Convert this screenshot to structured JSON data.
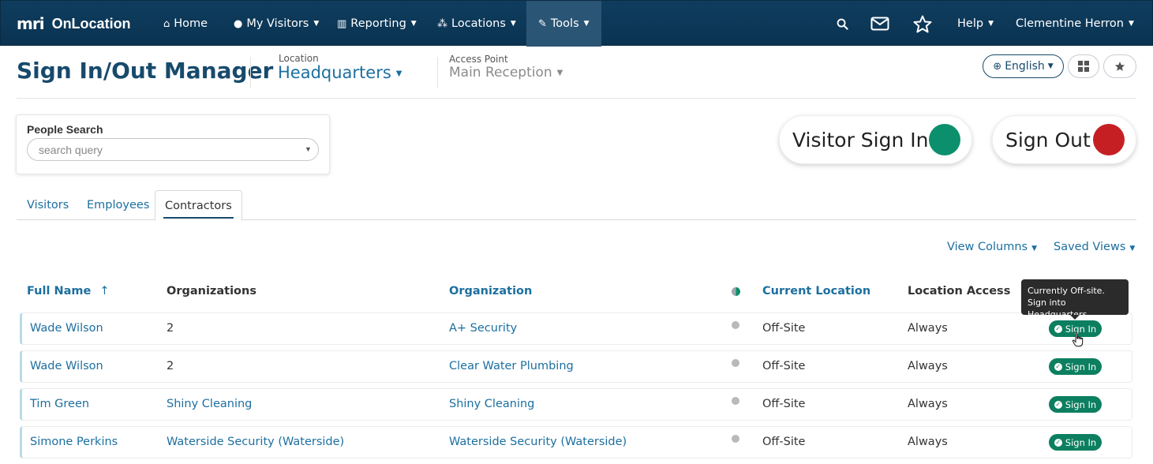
{
  "nav": {
    "brand_mark": "mri",
    "brand_name": "OnLocation",
    "home": "Home",
    "my_visitors": "My Visitors",
    "reporting": "Reporting",
    "locations": "Locations",
    "tools": "Tools",
    "help": "Help",
    "user": "Clementine Herron"
  },
  "header": {
    "title": "Sign In/Out Manager",
    "location_label": "Location",
    "location_value": "Headquarters",
    "access_point_label": "Access Point",
    "access_point_value": "Main Reception",
    "language": "English"
  },
  "search": {
    "label": "People Search",
    "placeholder": "search query"
  },
  "actions": {
    "visitor_sign_in": "Visitor Sign In",
    "sign_out": "Sign Out"
  },
  "tabs": [
    {
      "label": "Visitors"
    },
    {
      "label": "Employees"
    },
    {
      "label": "Contractors"
    }
  ],
  "view_tools": {
    "view_columns": "View Columns",
    "saved_views": "Saved Views"
  },
  "table": {
    "headers": {
      "full_name": "Full Name",
      "sort_indicator": "↑",
      "organizations": "Organizations",
      "organization": "Organization",
      "current_location": "Current Location",
      "location_access": "Location Access"
    },
    "rows": [
      {
        "name": "Wade Wilson",
        "organizations": "2",
        "organization": "A+ Security",
        "current_location": "Off-Site",
        "access": "Always",
        "action": "Sign In"
      },
      {
        "name": "Wade Wilson",
        "organizations": "2",
        "organization": "Clear Water Plumbing",
        "current_location": "Off-Site",
        "access": "Always",
        "action": "Sign In"
      },
      {
        "name": "Tim Green",
        "organizations": "Shiny Cleaning",
        "organization": "Shiny Cleaning",
        "current_location": "Off-Site",
        "access": "Always",
        "action": "Sign In"
      },
      {
        "name": "Simone Perkins",
        "organizations": "Waterside Security (Waterside)",
        "organization": "Waterside Security (Waterside)",
        "current_location": "Off-Site",
        "access": "Always",
        "action": "Sign In"
      }
    ]
  },
  "tooltip": {
    "line1": "Currently Off-site.",
    "line2": "Sign into Headquarters"
  },
  "colors": {
    "nav_bg": "#0f3d5e",
    "primary": "#174a6c",
    "link": "#1c6fa0",
    "green": "#0c8f6c",
    "red": "#c51f24"
  }
}
